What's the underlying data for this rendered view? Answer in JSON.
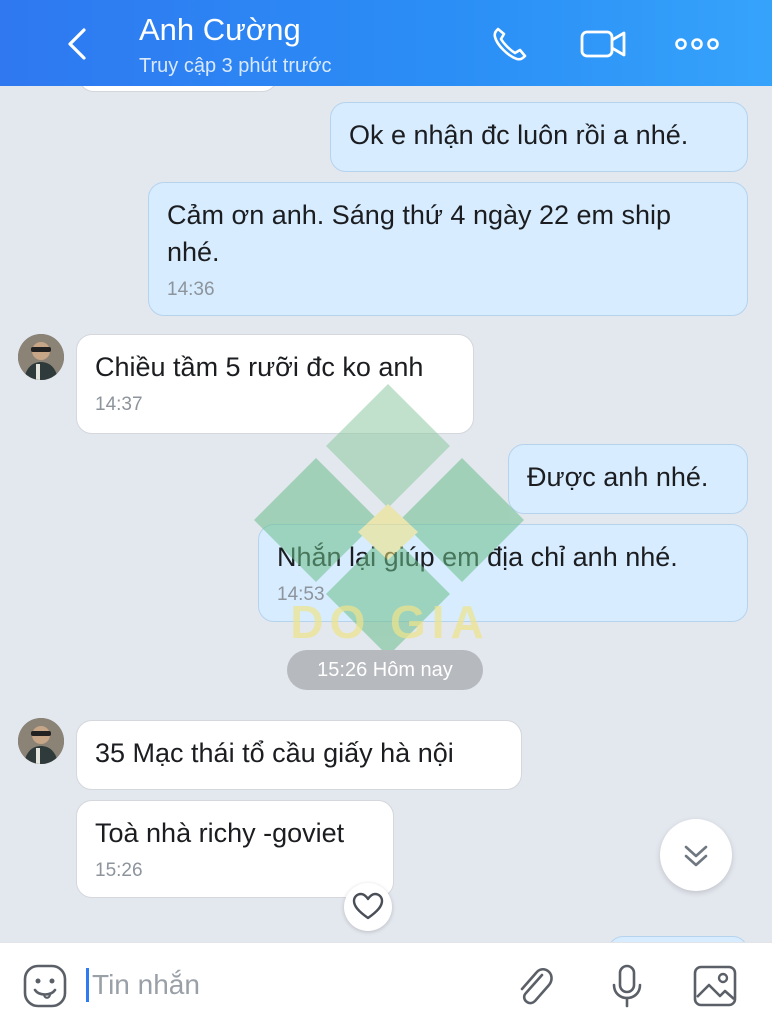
{
  "header": {
    "contact_name": "Anh Cường",
    "status": "Truy cập 3 phút trước",
    "icons": [
      "back-icon",
      "phone-icon",
      "video-call-icon",
      "more-icon"
    ]
  },
  "messages": [
    {
      "direction": "out",
      "text": "Ok e nhận đc luôn rồi a nhé.",
      "time": ""
    },
    {
      "direction": "out",
      "text": "Cảm ơn anh. Sáng thứ 4 ngày 22 em ship nhé.",
      "time": "14:36"
    },
    {
      "direction": "in",
      "text": "Chiều tầm 5 rưỡi đc ko anh",
      "time": "14:37"
    },
    {
      "direction": "out",
      "text": "Được anh nhé.",
      "time": ""
    },
    {
      "direction": "out",
      "text": "Nhắn lại giúp em địa chỉ anh nhé.",
      "time": "14:53"
    },
    {
      "direction": "in",
      "text": "35 Mạc thái tổ cầu giấy hà nội",
      "time": ""
    },
    {
      "direction": "in",
      "text": "Toà nhà richy -goviet",
      "time": "15:26"
    }
  ],
  "date_divider": "15:26 Hôm nay",
  "watermark_text": "DO GIA",
  "input": {
    "placeholder": "Tin nhắn",
    "icons": [
      "emoji-icon",
      "attachment-icon",
      "microphone-icon",
      "image-icon"
    ]
  },
  "colors": {
    "header": "#2f78f0",
    "outgoing_bubble": "#d7ecfe",
    "incoming_bubble": "#ffffff",
    "chat_background": "#e3e7ee"
  }
}
